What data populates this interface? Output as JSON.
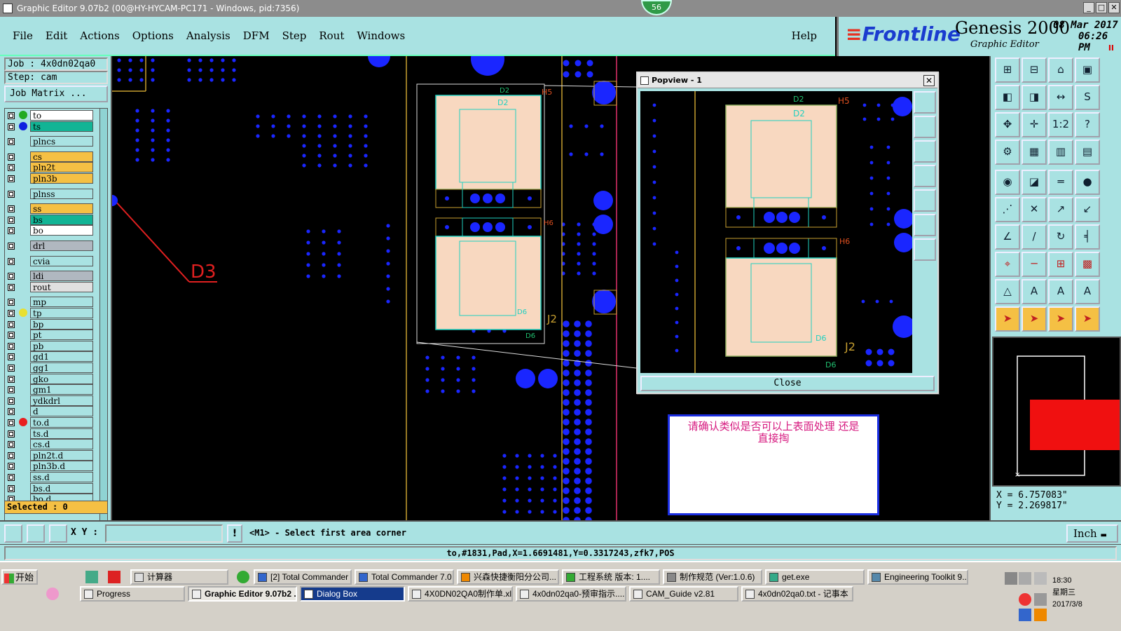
{
  "window": {
    "title": "Graphic Editor 9.07b2 (00@HY-HYCAM-PC171 - Windows, pid:7356)",
    "badge": "56",
    "controls": [
      "_",
      "□",
      "✕"
    ]
  },
  "menu": {
    "items": [
      "File",
      "Edit",
      "Actions",
      "Options",
      "Analysis",
      "DFM",
      "Step",
      "Rout",
      "Windows"
    ],
    "help": "Help"
  },
  "brand": {
    "logo": "Frontline",
    "product": "Genesis 2000",
    "subtitle": "Graphic Editor",
    "date": "08 Mar 2017",
    "time": "06:26 PM",
    "pause": "II"
  },
  "left_panel": {
    "job": "Job : 4x0dn02qa0",
    "step": "Step: cam",
    "job_matrix": "Job Matrix ...",
    "selected": "Selected : 0",
    "layers": [
      {
        "name": "to",
        "bg": "#ffffff",
        "dot": "#22aa22",
        "dot2": "#1020e0"
      },
      {
        "name": "ts",
        "bg": "#12b495",
        "dot": "#1020e0"
      },
      {
        "name": "plncs",
        "bg": "#a9e2e2",
        "dot": ""
      },
      {
        "name": "cs",
        "bg": "#f5c044",
        "dot": ""
      },
      {
        "name": "pln2t",
        "bg": "#f5c044",
        "dot": ""
      },
      {
        "name": "pln3b",
        "bg": "#f5c044",
        "dot": ""
      },
      {
        "name": "plnss",
        "bg": "#a9e2e2",
        "dot": ""
      },
      {
        "name": "ss",
        "bg": "#f5c044",
        "dot": ""
      },
      {
        "name": "bs",
        "bg": "#12b495",
        "dot": ""
      },
      {
        "name": "bo",
        "bg": "#ffffff",
        "dot": ""
      },
      {
        "name": "drl",
        "bg": "#b0b8c0",
        "dot": ""
      },
      {
        "name": "cvia",
        "bg": "#a9e2e2",
        "dot": ""
      },
      {
        "name": "ldi",
        "bg": "#b0b8c0",
        "dot": ""
      },
      {
        "name": "rout",
        "bg": "#e0e0e0",
        "dot": ""
      },
      {
        "name": "mp",
        "bg": "#a9e2e2",
        "dot": ""
      },
      {
        "name": "tp",
        "bg": "#a9e2e2",
        "dot": "#e8e030"
      },
      {
        "name": "bp",
        "bg": "#a9e2e2",
        "dot": ""
      },
      {
        "name": "pt",
        "bg": "#a9e2e2",
        "dot": ""
      },
      {
        "name": "pb",
        "bg": "#a9e2e2",
        "dot": ""
      },
      {
        "name": "gd1",
        "bg": "#a9e2e2",
        "dot": ""
      },
      {
        "name": "gg1",
        "bg": "#a9e2e2",
        "dot": ""
      },
      {
        "name": "gko",
        "bg": "#a9e2e2",
        "dot": ""
      },
      {
        "name": "gm1",
        "bg": "#a9e2e2",
        "dot": ""
      },
      {
        "name": "ydkdrl",
        "bg": "#a9e2e2",
        "dot": ""
      },
      {
        "name": "d",
        "bg": "#a9e2e2",
        "dot": ""
      },
      {
        "name": "to.d",
        "bg": "#a9e2e2",
        "dot": "#e82020"
      },
      {
        "name": "ts.d",
        "bg": "#a9e2e2",
        "dot": ""
      },
      {
        "name": "cs.d",
        "bg": "#a9e2e2",
        "dot": ""
      },
      {
        "name": "pln2t.d",
        "bg": "#a9e2e2",
        "dot": ""
      },
      {
        "name": "pln3b.d",
        "bg": "#a9e2e2",
        "dot": ""
      },
      {
        "name": "ss.d",
        "bg": "#a9e2e2",
        "dot": ""
      },
      {
        "name": "bs.d",
        "bg": "#a9e2e2",
        "dot": ""
      },
      {
        "name": "bo.d",
        "bg": "#a9e2e2",
        "dot": ""
      }
    ]
  },
  "canvas": {
    "labels": {
      "d2": "D2",
      "h5": "H5",
      "h6": "H6",
      "d6": "D6",
      "j2": "J2",
      "d3": "D3"
    }
  },
  "popview": {
    "title": "Popview - 1",
    "close_label": "Close",
    "labels": {
      "d2": "D2",
      "h5": "H5",
      "h6": "H6",
      "d6": "D6",
      "j2": "J2"
    }
  },
  "note": {
    "line1": "请确认类似是否可以上表面处理   还是",
    "line2": "直接掏"
  },
  "coords": {
    "x": "X = 6.757083\"",
    "y": "Y = 2.269817\""
  },
  "command_bar": {
    "xy_label": "X Y :",
    "input_value": "",
    "warn": "!",
    "prompt": "<M1> - Select first area corner",
    "units": "Inch"
  },
  "status": {
    "text": "to,#1831,Pad,X=1.6691481,Y=0.3317243,zfk7,POS"
  },
  "taskbar": {
    "start": "开始",
    "row1": [
      "计算器",
      "[2] Total Commander ...",
      "Total Commander 7.0 ...",
      "兴森快捷衡阳分公司...",
      "工程系统  版本: 1....",
      "制作规范 (Ver:1.0.6)",
      "get.exe",
      "Engineering Toolkit 9...."
    ],
    "row2": [
      "Progress",
      "Graphic Editor 9.07b2 ...",
      "Dialog Box",
      "4X0DN02QA0制作单.xls...",
      "4x0dn02qa0-预审指示....",
      "CAM_Guide v2.81",
      "4x0dn02qa0.txt - 记事本"
    ],
    "clock_time": "18:30",
    "clock_day": "星期三",
    "clock_date": "2017/3/8"
  }
}
